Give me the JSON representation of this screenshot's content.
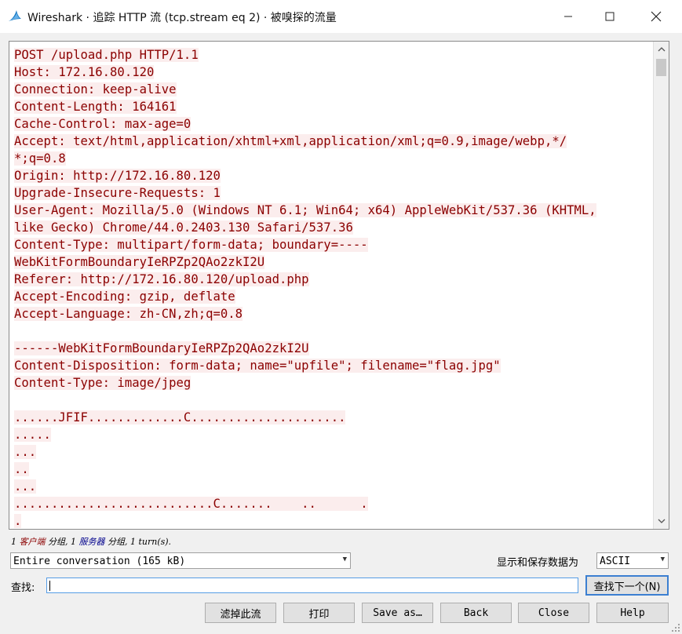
{
  "window": {
    "title": "Wireshark · 追踪 HTTP 流 (tcp.stream eq 2) · 被嗅探的流量",
    "icon": "wireshark-fin-icon",
    "controls": [
      "minimize-icon",
      "maximize-icon",
      "close-icon"
    ]
  },
  "stream_lines": [
    "POST /upload.php HTTP/1.1",
    "Host: 172.16.80.120",
    "Connection: keep-alive",
    "Content-Length: 164161",
    "Cache-Control: max-age=0",
    "Accept: text/html,application/xhtml+xml,application/xml;q=0.9,image/webp,*/",
    "*;q=0.8",
    "Origin: http://172.16.80.120",
    "Upgrade-Insecure-Requests: 1",
    "User-Agent: Mozilla/5.0 (Windows NT 6.1; Win64; x64) AppleWebKit/537.36 (KHTML,",
    "like Gecko) Chrome/44.0.2403.130 Safari/537.36",
    "Content-Type: multipart/form-data; boundary=----",
    "WebKitFormBoundaryIeRPZp2QAo2zkI2U",
    "Referer: http://172.16.80.120/upload.php",
    "Accept-Encoding: gzip, deflate",
    "Accept-Language: zh-CN,zh;q=0.8",
    "",
    "------WebKitFormBoundaryIeRPZp2QAo2zkI2U",
    "Content-Disposition: form-data; name=\"upfile\"; filename=\"flag.jpg\"",
    "Content-Type: image/jpeg",
    "",
    "......JFIF.............C.....................",
    ".....",
    "...",
    "..",
    "...",
    "...........................C.......    ..      .",
    "."
  ],
  "summary": {
    "prefix": "1 ",
    "client": "客户端",
    "mid1": " 分组, 1 ",
    "server": "服务器",
    "suffix": " 分组, 1 turn(s)."
  },
  "conversation_select": {
    "value": "Entire conversation (165 kB)"
  },
  "display_label": "显示和保存数据为",
  "encoding_select": {
    "value": "ASCII"
  },
  "find": {
    "label": "查找:",
    "value": "",
    "next_button": "查找下一个(N)"
  },
  "buttons": {
    "filter_out": "滤掉此流",
    "print": "打印",
    "save_as": "Save as…",
    "back": "Back",
    "close": "Close",
    "help": "Help"
  },
  "colors": {
    "client_text": "#8b0000",
    "client_bg": "#fbeded",
    "server_text": "#00008b"
  }
}
